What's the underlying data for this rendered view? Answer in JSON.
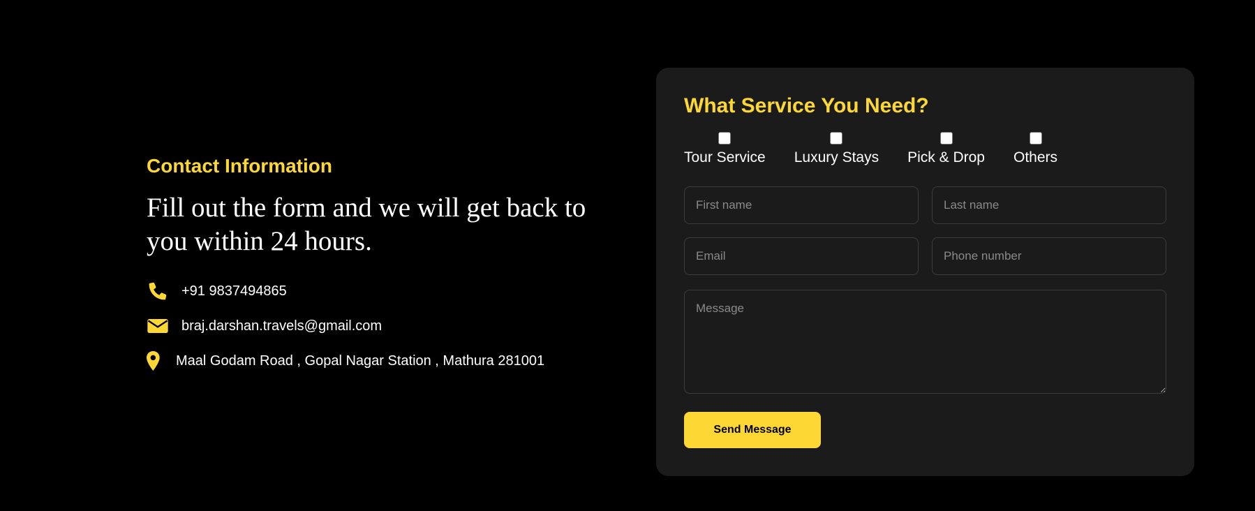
{
  "colors": {
    "background": "#000000",
    "accent": "#fdd835",
    "card": "#1b1b1b",
    "text": "#ffffff",
    "placeholder": "#8a8a8a"
  },
  "contact": {
    "title": "Contact Information",
    "lead": "Fill out the form and we will get back to you within 24 hours.",
    "phone": {
      "icon": "phone-icon",
      "text": "+91 9837494865"
    },
    "email": {
      "icon": "envelope-icon",
      "text": "braj.darshan.travels@gmail.com"
    },
    "address": {
      "icon": "location-pin-icon",
      "text": "Maal Godam Road , Gopal Nagar Station , Mathura 281001"
    }
  },
  "form": {
    "title": "What Service You Need?",
    "services": [
      {
        "label": "Tour Service",
        "checked": false
      },
      {
        "label": "Luxury Stays",
        "checked": false
      },
      {
        "label": "Pick & Drop",
        "checked": false
      },
      {
        "label": "Others",
        "checked": false
      }
    ],
    "first_name": {
      "placeholder": "First name",
      "value": ""
    },
    "last_name": {
      "placeholder": "Last name",
      "value": ""
    },
    "email": {
      "placeholder": "Email",
      "value": ""
    },
    "phone": {
      "placeholder": "Phone number",
      "value": ""
    },
    "message": {
      "placeholder": "Message",
      "value": ""
    },
    "submit_label": "Send Message"
  }
}
